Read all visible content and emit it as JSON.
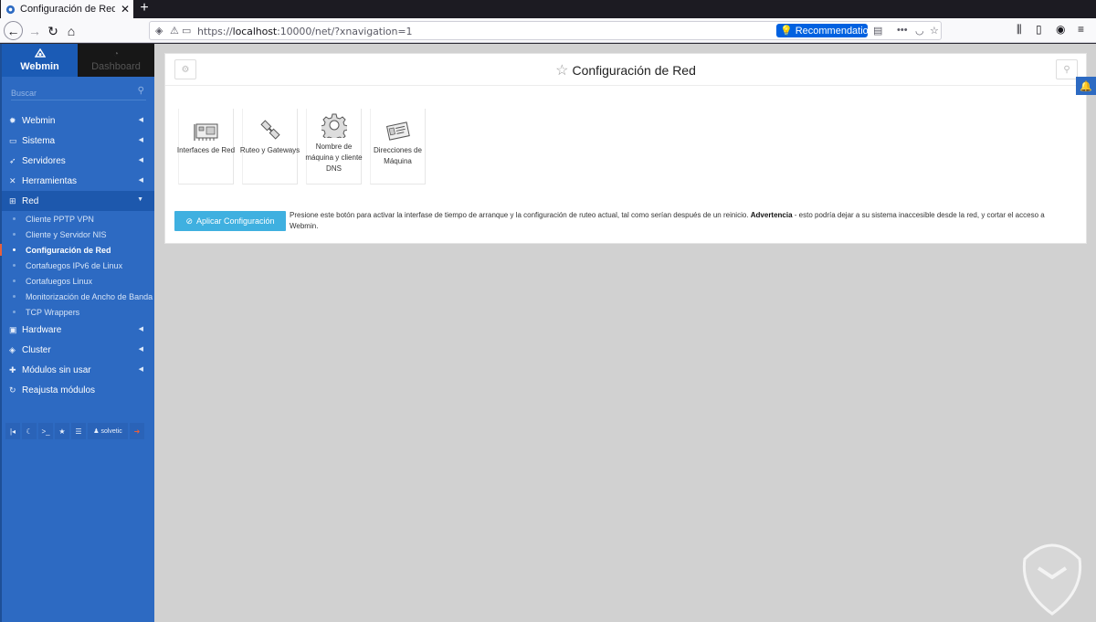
{
  "browser": {
    "tab_title": "Configuración de Red —",
    "url_prefix": "https://",
    "url_host": "localhost",
    "url_rest": ":10000/net/?xnavigation=1",
    "recommendation_label": "Recommendation"
  },
  "sidebar": {
    "tab_webmin": "Webmin",
    "tab_dashboard": "Dashboard",
    "search_placeholder": "Buscar",
    "items": [
      {
        "label": "Webmin",
        "icon": "gear-icon"
      },
      {
        "label": "Sistema",
        "icon": "monitor-icon"
      },
      {
        "label": "Servidores",
        "icon": "rocket-icon"
      },
      {
        "label": "Herramientas",
        "icon": "wrench-icon"
      },
      {
        "label": "Red",
        "icon": "network-icon"
      }
    ],
    "red_subitems": [
      "Cliente PPTP VPN",
      "Cliente y Servidor NIS",
      "Configuración de Red",
      "Cortafuegos IPv6 de Linux",
      "Cortafuegos Linux",
      "Monitorización de Ancho de Banda",
      "TCP Wrappers"
    ],
    "items_after": [
      {
        "label": "Hardware",
        "icon": "hdd-icon"
      },
      {
        "label": "Cluster",
        "icon": "layers-icon"
      },
      {
        "label": "Módulos sin usar",
        "icon": "puzzle-icon"
      },
      {
        "label": "Reajusta módulos",
        "icon": "refresh-icon"
      }
    ],
    "user_label": "solvetic"
  },
  "main": {
    "title": "Configuración de Red",
    "modules": [
      {
        "label": "Interfaces de Red",
        "icon": "network-card-icon"
      },
      {
        "label": "Ruteo y Gateways",
        "icon": "route-plug-icon"
      },
      {
        "label": "Nombre de máquina y cliente DNS",
        "icon": "cog-icon"
      },
      {
        "label": "Direcciones de Máquina",
        "icon": "address-card-icon"
      }
    ],
    "apply_button": "Aplicar Configuración",
    "apply_desc_pre": "Presione este botón para activar la interfase de tiempo de arranque y la configuración de ruteo actual, tal como serían después de un reinicio. ",
    "apply_desc_bold": "Advertencia",
    "apply_desc_post": " - esto podría dejar a su sistema inaccesible desde la red, y cortar el acceso a Webmin."
  },
  "colors": {
    "sidebar": "#2d6ac2",
    "accent_button": "#3fb0e0",
    "current_marker": "#e8603c"
  }
}
